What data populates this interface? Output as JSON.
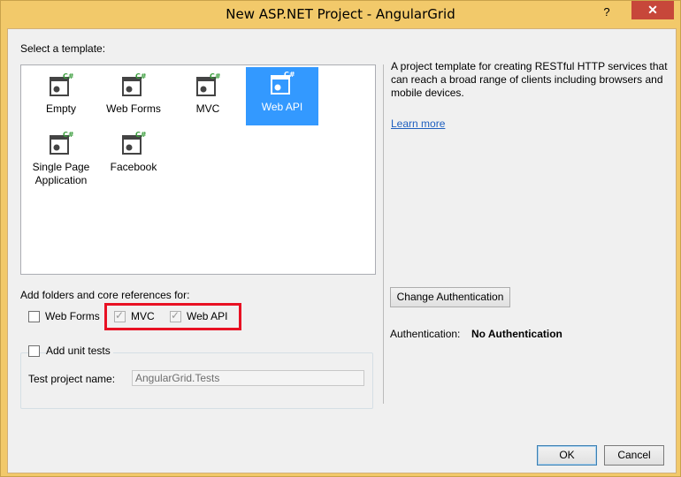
{
  "window": {
    "title": "New ASP.NET Project - AngularGrid",
    "help": "?",
    "close": "✕"
  },
  "templates": {
    "label": "Select a template:",
    "items": [
      {
        "label": "Empty",
        "selected": false
      },
      {
        "label": "Web Forms",
        "selected": false
      },
      {
        "label": "MVC",
        "selected": false
      },
      {
        "label": "Web API",
        "selected": true
      },
      {
        "label": "Single Page Application",
        "label_line1": "Single Page",
        "label_line2": "Application",
        "selected": false
      },
      {
        "label": "Facebook",
        "selected": false
      }
    ],
    "icon_badge": "C#"
  },
  "references": {
    "label": "Add folders and core references for:",
    "web_forms": {
      "label": "Web Forms",
      "checked": false
    },
    "mvc": {
      "label": "MVC",
      "checked": true
    },
    "web_api": {
      "label": "Web API",
      "checked": true
    }
  },
  "unit_tests": {
    "label": "Add unit tests",
    "checked": false,
    "test_project_label": "Test project name:",
    "test_project_value": "AngularGrid.Tests"
  },
  "description": {
    "text": "A project template for creating RESTful HTTP services that can reach a broad range of clients including browsers and mobile devices.",
    "learn_more": "Learn more"
  },
  "authentication": {
    "change_button": "Change Authentication",
    "label": "Authentication:",
    "value": "No Authentication"
  },
  "buttons": {
    "ok": "OK",
    "cancel": "Cancel"
  },
  "colors": {
    "title_bar": "#f2c96a",
    "close_button": "#c7473a",
    "selection": "#3399ff",
    "highlight_box": "#e81123",
    "link": "#1e5fbf"
  }
}
